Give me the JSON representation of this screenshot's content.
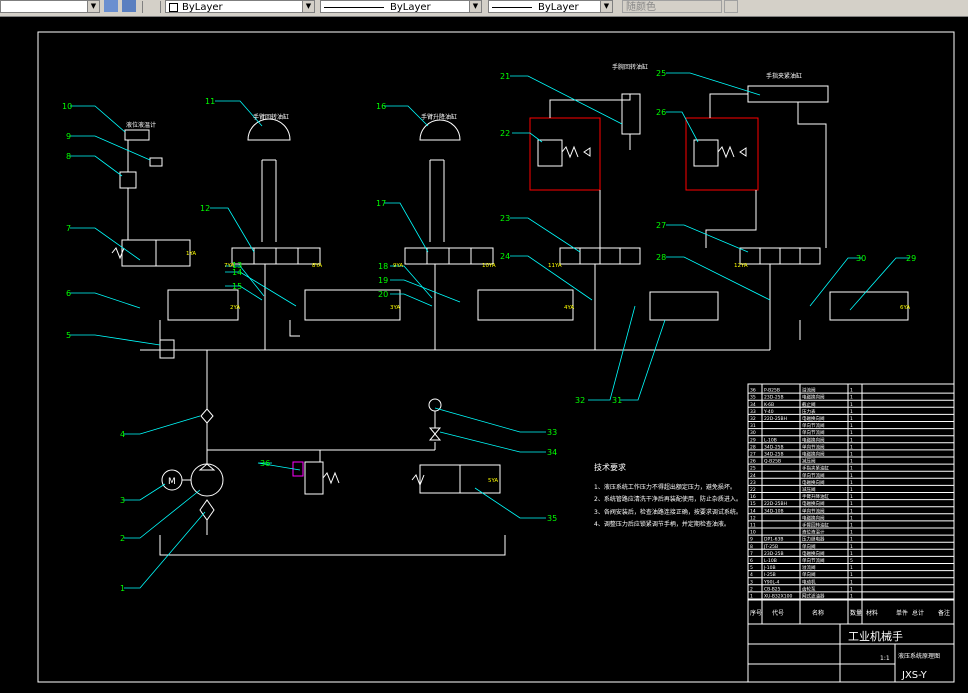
{
  "toolbar": {
    "layer_label": "ByLayer",
    "linetype_label": "ByLayer",
    "lineweight_label": "ByLayer",
    "color_label": "随颜色"
  },
  "callouts": [
    "10",
    "9",
    "8",
    "7",
    "6",
    "5",
    "4",
    "3",
    "2",
    "1",
    "11",
    "12",
    "13",
    "14",
    "15",
    "16",
    "17",
    "18",
    "19",
    "20",
    "21",
    "22",
    "23",
    "24",
    "25",
    "26",
    "27",
    "28",
    "29",
    "30",
    "31",
    "32",
    "33",
    "34",
    "35",
    "36"
  ],
  "component_labels": {
    "c10": "液位液温计",
    "c11": "手臂回转油缸",
    "c16": "手臂升降油缸",
    "c21": "手腕回转油缸",
    "c25": "手指夹紧油缸"
  },
  "coils": [
    "1YA",
    "2YA",
    "3YA",
    "4YA",
    "5YA",
    "6YA",
    "7YA",
    "8YA",
    "9YA",
    "10YA",
    "11YA",
    "12YA"
  ],
  "tech_req": {
    "title": "技术要求",
    "items": [
      "1、液压系统工作压力不得超出额定压力，避免损坏。",
      "2、系统管路应清洗干净后再装配使用，防止杂质进入。",
      "3、各阀安装后，检查油路连接正确，按要求调试系统。",
      "4、调整压力后应锁紧调节手柄，并定期检查油液。"
    ]
  },
  "bom_rows": [
    [
      "36",
      "P-B25B",
      "溢流阀",
      "1"
    ],
    [
      "35",
      "23D-25B",
      "电磁换向阀",
      "1"
    ],
    [
      "34",
      "K-6B",
      "截止阀",
      "1"
    ],
    [
      "33",
      "Y-40",
      "压力表",
      "1"
    ],
    [
      "32",
      "22D-25BH",
      "电磁换向阀",
      "1"
    ],
    [
      "31",
      "",
      "单向节流阀",
      "1"
    ],
    [
      "30",
      "",
      "单向节流阀",
      "1"
    ],
    [
      "29",
      "L-10B",
      "电磁换向阀",
      "1"
    ],
    [
      "28",
      "34D-25B",
      "单向节流阀",
      "1"
    ],
    [
      "27",
      "34D-25B",
      "电磁换向阀",
      "1"
    ],
    [
      "26",
      "Q-B25B",
      "减压阀",
      "1"
    ],
    [
      "25",
      "",
      "手指夹紧油缸",
      "1"
    ],
    [
      "24",
      "",
      "单向节流阀",
      "1"
    ],
    [
      "23",
      "",
      "电磁换向阀",
      "1"
    ],
    [
      "22",
      "",
      "减压阀",
      "1"
    ],
    [
      "16",
      "",
      "手臂升降油缸",
      "1"
    ],
    [
      "15",
      "22D-25BH",
      "电磁换向阀",
      "1"
    ],
    [
      "14",
      "34D-10B",
      "单向节流阀",
      "1"
    ],
    [
      "12",
      "",
      "电磁换向阀",
      "1"
    ],
    [
      "11",
      "",
      "手臂回转油缸",
      "1"
    ],
    [
      "10",
      "",
      "液位液温计",
      "1"
    ],
    [
      "9",
      "DP1-63B",
      "压力继电器",
      "1"
    ],
    [
      "8",
      "JT-25B",
      "单向阀",
      "1"
    ],
    [
      "7",
      "23D-25B",
      "电磁换向阀",
      "1"
    ],
    [
      "6",
      "L-10B",
      "单向节流阀",
      "5"
    ],
    [
      "5",
      "J-10B",
      "溢流阀",
      "1"
    ],
    [
      "4",
      "I-25B",
      "单向阀",
      "1"
    ],
    [
      "3",
      "Y90L-4",
      "电动机",
      "1"
    ],
    [
      "2",
      "CB-B25",
      "齿轮泵",
      "1"
    ],
    [
      "1",
      "XU-B32X100",
      "网式滤油器",
      "1"
    ]
  ],
  "bom_header": [
    "序号",
    "代号",
    "名称",
    "数量",
    "材料",
    "单件",
    "总计",
    "备注"
  ],
  "title_block": {
    "title": "工业机械手",
    "subtitle": "液压系统原理图",
    "scale": "1:1",
    "drawing_no": "JXS-Y"
  },
  "colors": {
    "background": "#000000",
    "lines": "#ffffff",
    "labels": "#00ff00",
    "leaders": "#00ffff",
    "highlight": "#ff0000",
    "dimension": "#ff00ff"
  }
}
